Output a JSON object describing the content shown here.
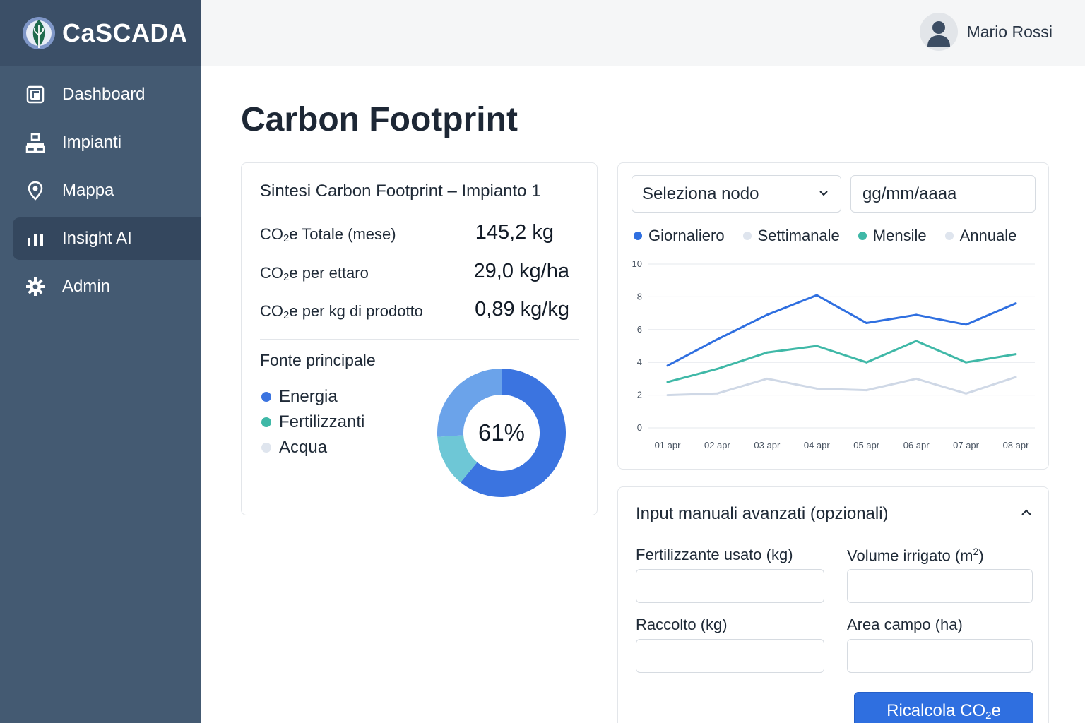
{
  "app": {
    "name": "CaSCADA"
  },
  "sidebar": {
    "items": [
      {
        "label": "Dashboard",
        "icon": "dashboard-icon"
      },
      {
        "label": "Impianti",
        "icon": "plants-icon"
      },
      {
        "label": "Mappa",
        "icon": "map-pin-icon"
      },
      {
        "label": "Insight AI",
        "icon": "bar-chart-icon",
        "active": true
      },
      {
        "label": "Admin",
        "icon": "gear-icon"
      }
    ]
  },
  "header": {
    "user_name": "Mario Rossi"
  },
  "page": {
    "title": "Carbon Footprint"
  },
  "summary": {
    "title": "Sintesi Carbon Footprint – Impianto 1",
    "metrics": [
      {
        "label_pre": "CO",
        "label_sub": "2",
        "label_post": "e Totale (mese)",
        "value": "145,2 kg"
      },
      {
        "label_pre": "CO",
        "label_sub": "2",
        "label_post": "e per ettaro",
        "value": "29,0 kg/ha"
      },
      {
        "label_pre": "CO",
        "label_sub": "2",
        "label_post": "e per kg di prodotto",
        "value": "0,89 kg/kg"
      }
    ],
    "source_title": "Fonte principale",
    "sources": [
      {
        "label": "Energia",
        "color": "#3b74e0"
      },
      {
        "label": "Fertilizzanti",
        "color": "#3fb8a7"
      },
      {
        "label": "Acqua",
        "color": "#dfe5ee"
      }
    ],
    "donut": {
      "center_label": "61%",
      "segments": [
        {
          "name": "Energia",
          "percent": 61,
          "color": "#3b74e0"
        },
        {
          "name": "segment-2",
          "percent": 13,
          "color": "#6ec7d6"
        },
        {
          "name": "segment-3",
          "percent": 26,
          "color": "#6ba3ea"
        }
      ]
    }
  },
  "chart_panel": {
    "node_select": "Seleziona nodo",
    "date_placeholder": "gg/mm/aaaa",
    "periods": [
      {
        "label": "Giornaliero",
        "color": "#2f6fe0"
      },
      {
        "label": "Settimanale",
        "color": "#dfe5ee"
      },
      {
        "label": "Mensile",
        "color": "#3fb8a7"
      },
      {
        "label": "Annuale",
        "color": "#dfe5ee"
      }
    ]
  },
  "chart_data": {
    "type": "line",
    "x": [
      "01 apr",
      "02 apr",
      "03 apr",
      "04 apr",
      "05 apr",
      "06 apr",
      "07 apr",
      "08 apr"
    ],
    "yticks": [
      0,
      2,
      4,
      6,
      8,
      10
    ],
    "ylim": [
      0,
      10
    ],
    "grid": true,
    "series": [
      {
        "color": "#2f6fe0",
        "values": [
          3.8,
          5.4,
          6.9,
          8.1,
          6.4,
          6.9,
          6.3,
          7.6
        ]
      },
      {
        "color": "#3fb8a7",
        "values": [
          2.8,
          3.6,
          4.6,
          5.0,
          4.0,
          5.3,
          4.0,
          4.5
        ]
      },
      {
        "color": "#cfd8e6",
        "values": [
          2.0,
          2.1,
          3.0,
          2.4,
          2.3,
          3.0,
          2.1,
          3.1
        ]
      }
    ]
  },
  "inputs": {
    "title": "Input manuali avanzati (opzionali)",
    "fields": [
      {
        "label": "Fertilizzante usato (kg)",
        "value": ""
      },
      {
        "label_pre": "Volume irrigato (m",
        "label_sup": "2",
        "label_post": ")",
        "value": ""
      },
      {
        "label": "Raccolto (kg)",
        "value": ""
      },
      {
        "label": "Area campo (ha)",
        "value": ""
      }
    ],
    "button_pre": "Ricalcola CO",
    "button_sub": "2",
    "button_post": "e"
  }
}
